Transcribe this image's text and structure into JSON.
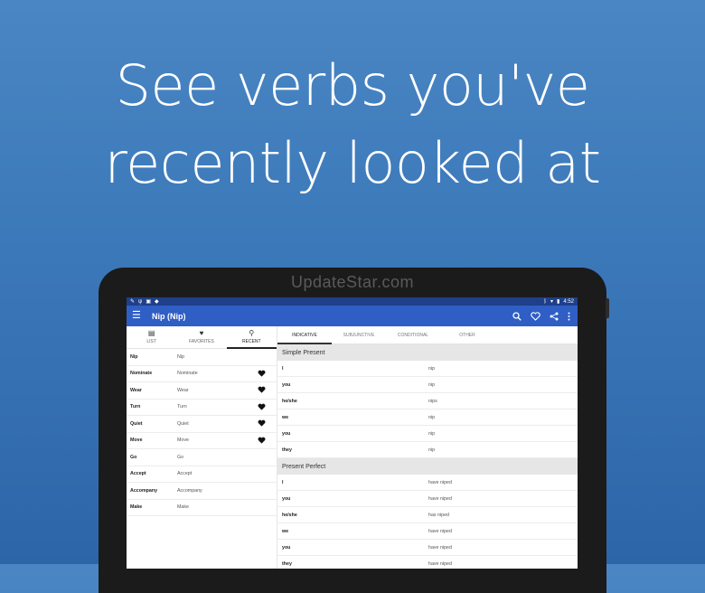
{
  "headline": {
    "line1": "See verbs you've",
    "line2": "recently looked at"
  },
  "watermark": "UpdateStar.com",
  "status_bar": {
    "time": "4:52"
  },
  "app_bar": {
    "title": "Nip (Nip)",
    "actions": [
      "search-icon",
      "heart-icon",
      "share-icon",
      "more-vert-icon"
    ]
  },
  "left_tabs": [
    {
      "label": "LIST",
      "icon": "document-icon"
    },
    {
      "label": "FAVORITES",
      "icon": "heart-icon"
    },
    {
      "label": "RECENT",
      "icon": "search-icon",
      "active": true
    }
  ],
  "recent_verbs": [
    {
      "verb": "Nip",
      "translation": "Nip",
      "favorite": false
    },
    {
      "verb": "Nominate",
      "translation": "Nominate",
      "favorite": true
    },
    {
      "verb": "Wear",
      "translation": "Wear",
      "favorite": true
    },
    {
      "verb": "Turn",
      "translation": "Turn",
      "favorite": true
    },
    {
      "verb": "Quiet",
      "translation": "Quiet",
      "favorite": true
    },
    {
      "verb": "Move",
      "translation": "Move",
      "favorite": true
    },
    {
      "verb": "Go",
      "translation": "Go",
      "favorite": false
    },
    {
      "verb": "Accept",
      "translation": "Accept",
      "favorite": false
    },
    {
      "verb": "Accompany",
      "translation": "Accompany",
      "favorite": false
    },
    {
      "verb": "Make",
      "translation": "Make",
      "favorite": false
    }
  ],
  "mood_tabs": [
    {
      "label": "INDICATIVE",
      "active": true
    },
    {
      "label": "SUBJUNCTIVE"
    },
    {
      "label": "CONDITIONAL"
    },
    {
      "label": "OTHER"
    }
  ],
  "tenses": [
    {
      "name": "Simple Present",
      "rows": [
        {
          "pronoun": "I",
          "form": "nip"
        },
        {
          "pronoun": "you",
          "form": "nip"
        },
        {
          "pronoun": "he/she",
          "form": "nips"
        },
        {
          "pronoun": "we",
          "form": "nip"
        },
        {
          "pronoun": "you",
          "form": "nip"
        },
        {
          "pronoun": "they",
          "form": "nip"
        }
      ]
    },
    {
      "name": "Present Perfect",
      "rows": [
        {
          "pronoun": "I",
          "form": "have niped"
        },
        {
          "pronoun": "you",
          "form": "have niped"
        },
        {
          "pronoun": "he/she",
          "form": "has niped"
        },
        {
          "pronoun": "we",
          "form": "have niped"
        },
        {
          "pronoun": "you",
          "form": "have niped"
        },
        {
          "pronoun": "they",
          "form": "have niped"
        }
      ]
    }
  ],
  "colors": {
    "background": "#3b78b9",
    "app_bar": "#2f5fc4",
    "status_bar": "#1f3f8a"
  }
}
